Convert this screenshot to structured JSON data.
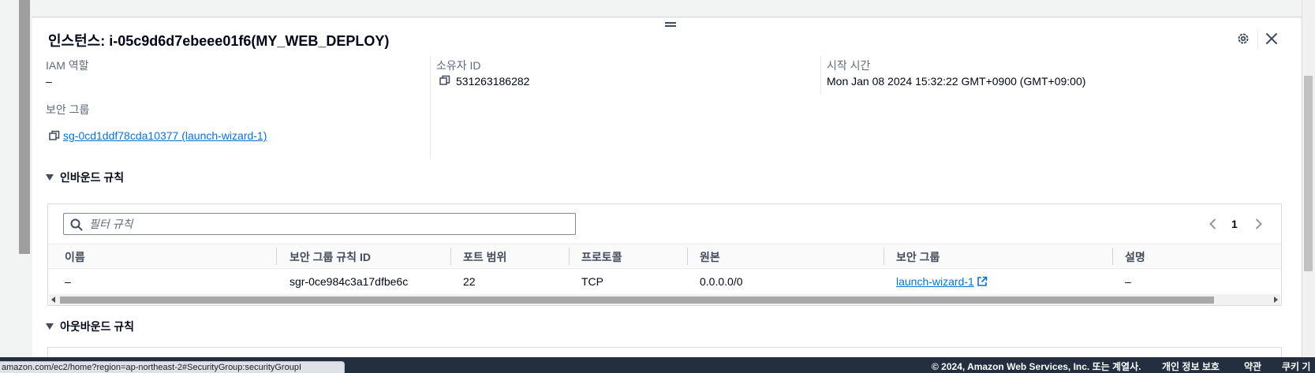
{
  "panel": {
    "title": "인스턴스: i-05c9d6d7ebeee01f6(MY_WEB_DEPLOY)",
    "settings_icon": "gear-icon",
    "close_icon": "close-icon"
  },
  "details": {
    "iam_role_label": "IAM 역할",
    "iam_role_value": "–",
    "owner_id_label": "소유자 ID",
    "owner_id_value": "531263186282",
    "launch_time_label": "시작 시간",
    "launch_time_value": "Mon Jan 08 2024 15:32:22 GMT+0900 (GMT+09:00)",
    "security_groups_label": "보안 그룹",
    "security_group_link": "sg-0cd1ddf78cda10377 (launch-wizard-1)"
  },
  "inbound": {
    "section_title": "인바운드 규칙",
    "filter_placeholder": "필터 규칙",
    "page_number": "1",
    "columns": [
      "이름",
      "보안 그룹 규칙 ID",
      "포트 범위",
      "프로토콜",
      "원본",
      "보안 그룹",
      "설명"
    ],
    "rows": [
      {
        "name": "–",
        "rule_id": "sgr-0ce984c3a17dfbe6c",
        "port_range": "22",
        "protocol": "TCP",
        "source": "0.0.0.0/0",
        "security_group": "launch-wizard-1",
        "description": "–"
      }
    ]
  },
  "outbound": {
    "section_title": "아웃바운드 규칙"
  },
  "status_bar": {
    "url": "amazon.com/ec2/home?region=ap-northeast-2#SecurityGroup:securityGroupI"
  },
  "footer": {
    "copyright": "© 2024, Amazon Web Services, Inc. 또는 계열사.",
    "privacy": "개인 정보 보호",
    "terms": "약관",
    "cookies": "쿠키 기"
  },
  "colors": {
    "link": "#0972d3",
    "text": "#000716",
    "footer_bg": "#232f3e"
  }
}
